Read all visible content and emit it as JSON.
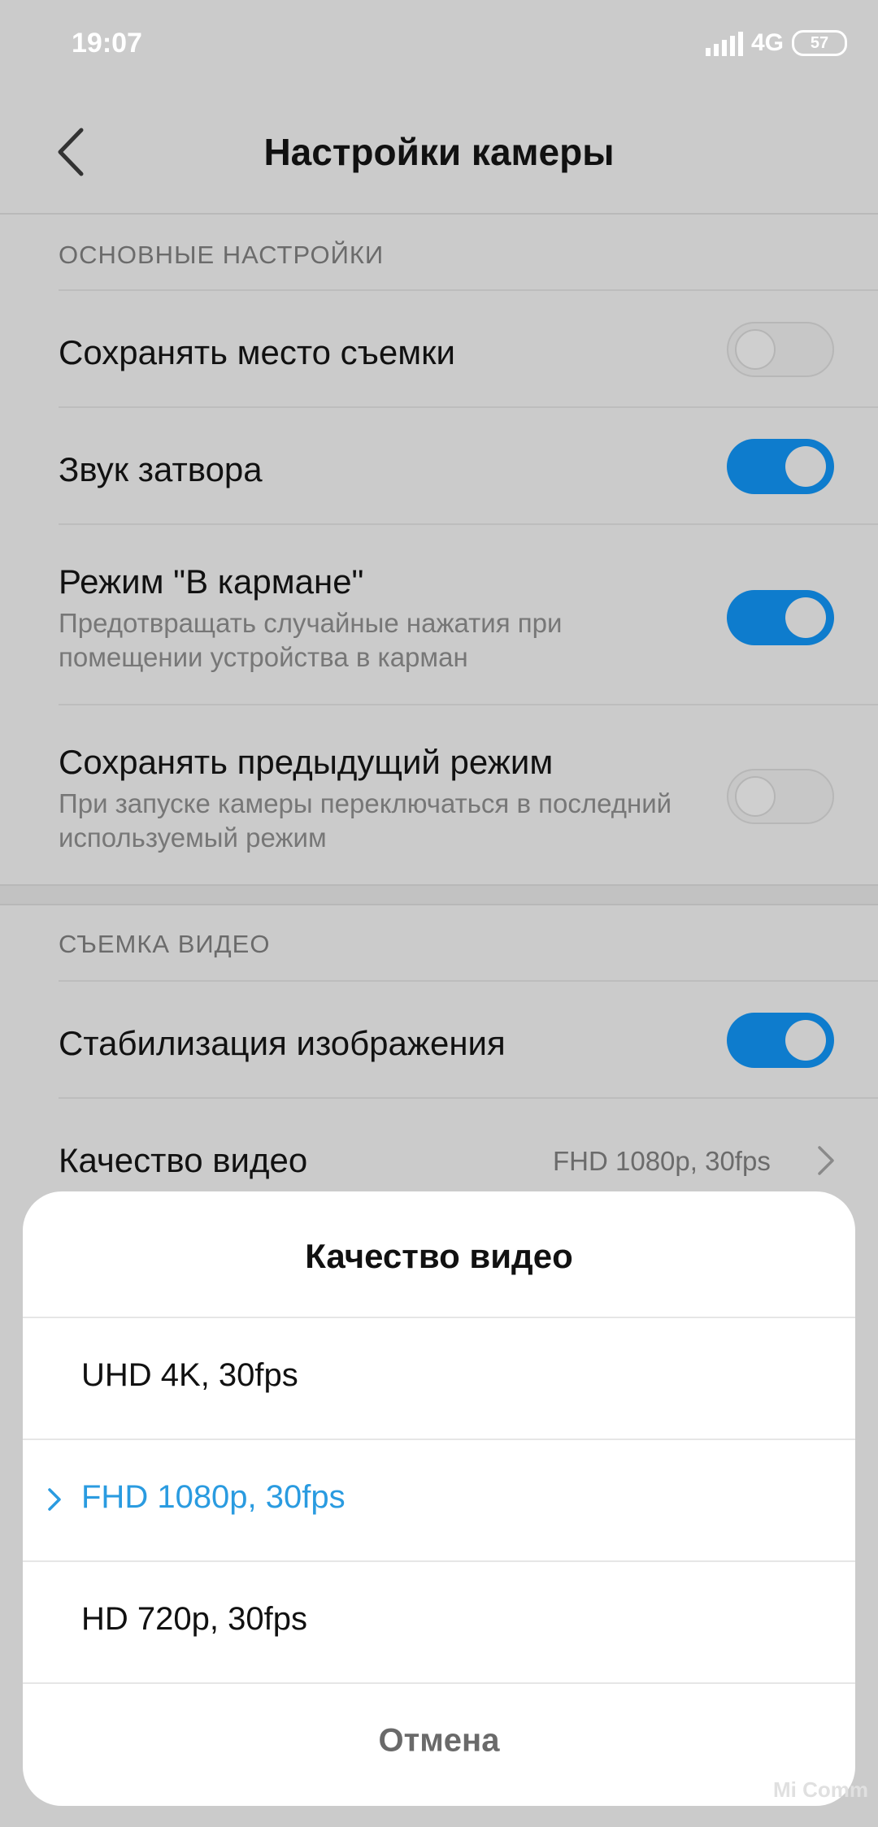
{
  "status_bar": {
    "time": "19:07",
    "network": "4G",
    "battery": "57"
  },
  "header": {
    "title": "Настройки камеры"
  },
  "sections": {
    "basic": {
      "label": "ОСНОВНЫЕ НАСТРОЙКИ",
      "items": [
        {
          "title": "Сохранять место съемки",
          "subtitle": "",
          "enabled": false
        },
        {
          "title": "Звук затвора",
          "subtitle": "",
          "enabled": true
        },
        {
          "title": "Режим \"В кармане\"",
          "subtitle": "Предотвращать случайные нажатия при помещении устройства в карман",
          "enabled": true
        },
        {
          "title": "Сохранять предыдущий режим",
          "subtitle": "При запуске камеры переключаться в последний используемый режим",
          "enabled": false
        }
      ]
    },
    "video": {
      "label": "СЪЕМКА ВИДЕО",
      "items": [
        {
          "title": "Стабилизация изображения",
          "enabled": true
        },
        {
          "title": "Качество видео",
          "value": "FHD 1080p, 30fps"
        }
      ]
    }
  },
  "dialog": {
    "title": "Качество видео",
    "options": [
      {
        "label": "UHD 4K, 30fps",
        "selected": false
      },
      {
        "label": "FHD 1080p, 30fps",
        "selected": true
      },
      {
        "label": "HD 720p, 30fps",
        "selected": false
      }
    ],
    "cancel_label": "Отмена"
  },
  "watermark": "Mi Comm",
  "colors": {
    "accent": "#0e7ccd",
    "selected_text": "#2a9be0",
    "scrim": "#cbcbcb"
  }
}
